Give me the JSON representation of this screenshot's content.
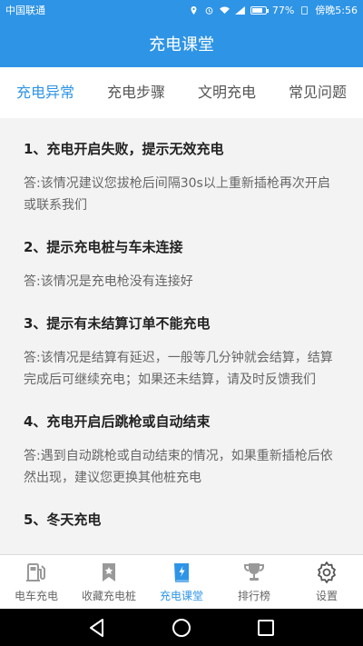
{
  "status_bar": {
    "carrier": "中国联通",
    "battery": "77%",
    "time": "傍晚5:56",
    "battery_level": 0.77
  },
  "header": {
    "title": "充电课堂"
  },
  "tabs": [
    {
      "label": "充电异常",
      "active": true
    },
    {
      "label": "充电步骤",
      "active": false
    },
    {
      "label": "文明充电",
      "active": false
    },
    {
      "label": "常见问题",
      "active": false
    }
  ],
  "faq": [
    {
      "q": "1、充电开启失败，提示无效充电",
      "a": "答:该情况建议您拔枪后间隔30s以上重新插枪再次开启或联系我们"
    },
    {
      "q": "2、提示充电桩与车未连接",
      "a": "答:该情况是充电枪没有连接好"
    },
    {
      "q": "3、提示有未结算订单不能充电",
      "a": "答:该情况是结算有延迟，一般等几分钟就会结算，结算完成后可继续充电；如果还未结算，请及时反馈我们"
    },
    {
      "q": "4、充电开启后跳枪或自动结束",
      "a": "答:遇到自动跳枪或自动结束的情况，如果重新插枪后依然出现，建议您更换其他桩充电"
    },
    {
      "q": "5、冬天充电",
      "a": ""
    }
  ],
  "bottom_nav": [
    {
      "label": "电车充电",
      "icon": "charging-station-icon",
      "active": false
    },
    {
      "label": "收藏充电桩",
      "icon": "bookmark-icon",
      "active": false
    },
    {
      "label": "充电课堂",
      "icon": "lightning-book-icon",
      "active": true
    },
    {
      "label": "排行榜",
      "icon": "trophy-icon",
      "active": false
    },
    {
      "label": "设置",
      "icon": "gear-icon",
      "active": false
    }
  ],
  "colors": {
    "primary": "#2e94e6",
    "inactive": "#999999"
  }
}
